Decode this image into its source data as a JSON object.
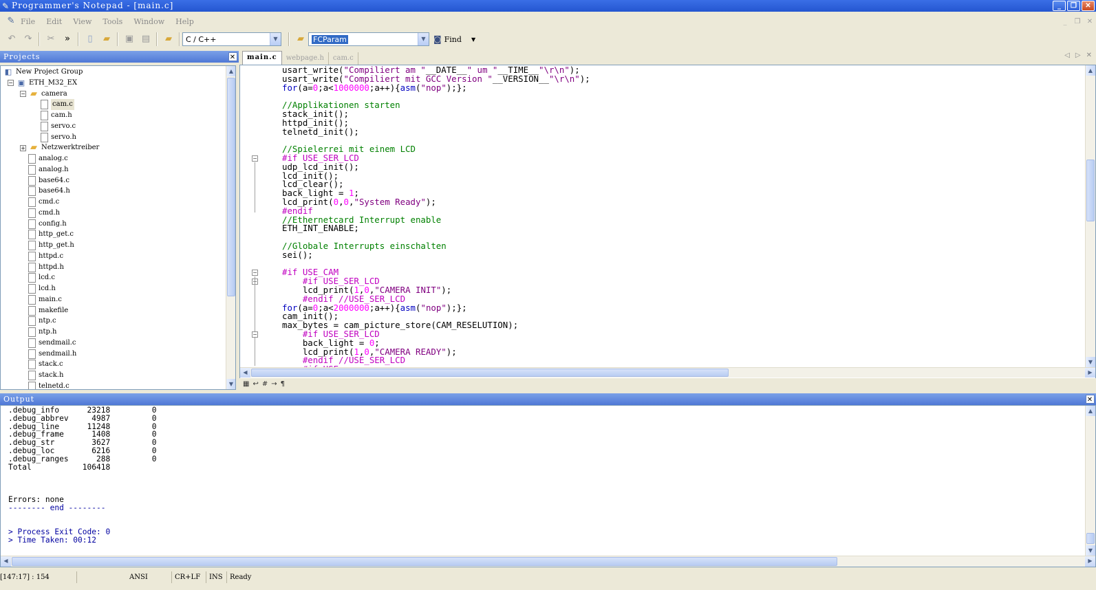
{
  "window": {
    "title": "Programmer's Notepad - [main.c]"
  },
  "menu": [
    "File",
    "Edit",
    "View",
    "Tools",
    "Window",
    "Help"
  ],
  "toolbar": {
    "scheme": "C / C++",
    "search_value": "FCParam",
    "find_label": "Find"
  },
  "projects": {
    "title": "Projects",
    "tree": [
      {
        "label": "New Project Group",
        "depth": 0,
        "icon": "group",
        "exp": ""
      },
      {
        "label": "ETH_M32_EX",
        "depth": 1,
        "icon": "proj",
        "exp": "−"
      },
      {
        "label": "camera",
        "depth": 2,
        "icon": "folder",
        "exp": "−"
      },
      {
        "label": "cam.c",
        "depth": 3,
        "icon": "file",
        "exp": "",
        "selected": true
      },
      {
        "label": "cam.h",
        "depth": 3,
        "icon": "file",
        "exp": ""
      },
      {
        "label": "servo.c",
        "depth": 3,
        "icon": "file",
        "exp": ""
      },
      {
        "label": "servo.h",
        "depth": 3,
        "icon": "file",
        "exp": ""
      },
      {
        "label": "Netzwerktreiber",
        "depth": 2,
        "icon": "folder",
        "exp": "+"
      },
      {
        "label": "analog.c",
        "depth": 2,
        "icon": "file",
        "exp": ""
      },
      {
        "label": "analog.h",
        "depth": 2,
        "icon": "file",
        "exp": ""
      },
      {
        "label": "base64.c",
        "depth": 2,
        "icon": "file",
        "exp": ""
      },
      {
        "label": "base64.h",
        "depth": 2,
        "icon": "file",
        "exp": ""
      },
      {
        "label": "cmd.c",
        "depth": 2,
        "icon": "file",
        "exp": ""
      },
      {
        "label": "cmd.h",
        "depth": 2,
        "icon": "file",
        "exp": ""
      },
      {
        "label": "config.h",
        "depth": 2,
        "icon": "file",
        "exp": ""
      },
      {
        "label": "http_get.c",
        "depth": 2,
        "icon": "file",
        "exp": ""
      },
      {
        "label": "http_get.h",
        "depth": 2,
        "icon": "file",
        "exp": ""
      },
      {
        "label": "httpd.c",
        "depth": 2,
        "icon": "file",
        "exp": ""
      },
      {
        "label": "httpd.h",
        "depth": 2,
        "icon": "file",
        "exp": ""
      },
      {
        "label": "lcd.c",
        "depth": 2,
        "icon": "file",
        "exp": ""
      },
      {
        "label": "lcd.h",
        "depth": 2,
        "icon": "file",
        "exp": ""
      },
      {
        "label": "main.c",
        "depth": 2,
        "icon": "file",
        "exp": ""
      },
      {
        "label": "makefile",
        "depth": 2,
        "icon": "make",
        "exp": ""
      },
      {
        "label": "ntp.c",
        "depth": 2,
        "icon": "file",
        "exp": ""
      },
      {
        "label": "ntp.h",
        "depth": 2,
        "icon": "file",
        "exp": ""
      },
      {
        "label": "sendmail.c",
        "depth": 2,
        "icon": "file",
        "exp": ""
      },
      {
        "label": "sendmail.h",
        "depth": 2,
        "icon": "file",
        "exp": ""
      },
      {
        "label": "stack.c",
        "depth": 2,
        "icon": "file",
        "exp": ""
      },
      {
        "label": "stack.h",
        "depth": 2,
        "icon": "file",
        "exp": ""
      },
      {
        "label": "telnetd.c",
        "depth": 2,
        "icon": "file",
        "exp": ""
      }
    ]
  },
  "tabs": [
    {
      "label": "main.c",
      "active": true
    },
    {
      "label": "webpage.h",
      "active": false
    },
    {
      "label": "cam.c",
      "active": false
    }
  ],
  "editor": {
    "lines": [
      [
        [
          "",
          "usart_write("
        ],
        [
          "st",
          "\"Compiliert am \""
        ],
        [
          "",
          "__DATE__"
        ],
        [
          "st",
          "\" um \""
        ],
        [
          "",
          "__TIME__"
        ],
        [
          "st",
          "\"\\r\\n\""
        ],
        [
          "",
          ");"
        ]
      ],
      [
        [
          "",
          "usart_write("
        ],
        [
          "st",
          "\"Compiliert mit GCC Version \""
        ],
        [
          "",
          "__VERSION__"
        ],
        [
          "st",
          "\"\\r\\n\""
        ],
        [
          "",
          ");"
        ]
      ],
      [
        [
          "kw",
          "for"
        ],
        [
          "",
          "(a="
        ],
        [
          "nm",
          "0"
        ],
        [
          "",
          ";a<"
        ],
        [
          "nm",
          "1000000"
        ],
        [
          "",
          ";a++){"
        ],
        [
          "kw",
          "asm"
        ],
        [
          "",
          "("
        ],
        [
          "st",
          "\"nop\""
        ],
        [
          "",
          ");};"
        ]
      ],
      [],
      [
        [
          "cm",
          "//Applikationen starten"
        ]
      ],
      [
        [
          "",
          "stack_init();"
        ]
      ],
      [
        [
          "",
          "httpd_init();"
        ]
      ],
      [
        [
          "",
          "telnetd_init();"
        ]
      ],
      [],
      [
        [
          "cm",
          "//Spielerrei mit einem LCD"
        ]
      ],
      [
        [
          "pp",
          "#if USE_SER_LCD"
        ]
      ],
      [
        [
          "",
          "udp_lcd_init();"
        ]
      ],
      [
        [
          "",
          "lcd_init();"
        ]
      ],
      [
        [
          "",
          "lcd_clear();"
        ]
      ],
      [
        [
          "",
          "back_light = "
        ],
        [
          "nm",
          "1"
        ],
        [
          "",
          ";"
        ]
      ],
      [
        [
          "",
          "lcd_print("
        ],
        [
          "nm",
          "0"
        ],
        [
          "",
          ","
        ],
        [
          "nm",
          "0"
        ],
        [
          "",
          ","
        ],
        [
          "st",
          "\"System Ready\""
        ],
        [
          "",
          ");"
        ]
      ],
      [
        [
          "pp",
          "#endif"
        ]
      ],
      [
        [
          "cm",
          "//Ethernetcard Interrupt enable"
        ]
      ],
      [
        [
          "",
          "ETH_INT_ENABLE;"
        ]
      ],
      [],
      [
        [
          "cm",
          "//Globale Interrupts einschalten"
        ]
      ],
      [
        [
          "",
          "sei();"
        ]
      ],
      [],
      [
        [
          "pp",
          "#if USE_CAM"
        ]
      ],
      [
        [
          "pp",
          "    #if USE_SER_LCD"
        ]
      ],
      [
        [
          "",
          "    lcd_print("
        ],
        [
          "nm",
          "1"
        ],
        [
          "",
          ","
        ],
        [
          "nm",
          "0"
        ],
        [
          "",
          ","
        ],
        [
          "st",
          "\"CAMERA INIT\""
        ],
        [
          "",
          ");"
        ]
      ],
      [
        [
          "pp",
          "    #endif //USE_SER_LCD"
        ]
      ],
      [
        [
          "kw",
          "for"
        ],
        [
          "",
          "(a="
        ],
        [
          "nm",
          "0"
        ],
        [
          "",
          ";a<"
        ],
        [
          "nm",
          "2000000"
        ],
        [
          "",
          ";a++){"
        ],
        [
          "kw",
          "asm"
        ],
        [
          "",
          "("
        ],
        [
          "st",
          "\"nop\""
        ],
        [
          "",
          ");};"
        ]
      ],
      [
        [
          "",
          "cam_init();"
        ]
      ],
      [
        [
          "",
          "max_bytes = cam_picture_store(CAM_RESELUTION);"
        ]
      ],
      [
        [
          "pp",
          "    #if USE_SER_LCD"
        ]
      ],
      [
        [
          "",
          "    back_light = "
        ],
        [
          "nm",
          "0"
        ],
        [
          "",
          ";"
        ]
      ],
      [
        [
          "",
          "    lcd_print("
        ],
        [
          "nm",
          "1"
        ],
        [
          "",
          ","
        ],
        [
          "nm",
          "0"
        ],
        [
          "",
          ","
        ],
        [
          "st",
          "\"CAMERA READY\""
        ],
        [
          "",
          ");"
        ]
      ],
      [
        [
          "pp",
          "    #endif //USE_SER_LCD"
        ]
      ],
      [
        [
          "pp",
          "    #if USE_..."
        ]
      ]
    ]
  },
  "output": {
    "title": "Output",
    "lines": [
      ".debug_info      23218         0",
      ".debug_abbrev     4987         0",
      ".debug_line      11248         0",
      ".debug_frame      1408         0",
      ".debug_str        3627         0",
      ".debug_loc        6216         0",
      ".debug_ranges      288         0",
      "Total           106418",
      "",
      "",
      "",
      "Errors: none",
      "-------- end --------",
      "",
      "",
      "> Process Exit Code: 0",
      "> Time Taken: 00:12"
    ]
  },
  "status": {
    "pos": "[147:17] : 154",
    "encoding": "ANSI",
    "lineend": "CR+LF",
    "mode": "INS",
    "state": "Ready"
  }
}
